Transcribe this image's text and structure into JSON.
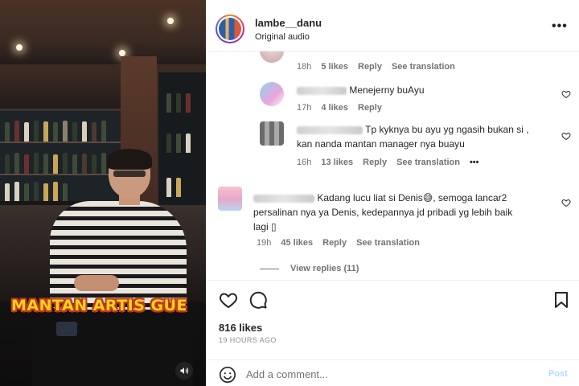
{
  "video": {
    "overlay_caption": "MANTAN ARTIS GUE",
    "mute_icon": "speaker-icon"
  },
  "post_header": {
    "username": "lambe__danu",
    "audio": "Original audio",
    "more_icon": "more-dots-icon"
  },
  "comments": [
    {
      "text": "",
      "time": "18h",
      "likes": "5 likes",
      "reply": "Reply",
      "translate": "See translation"
    },
    {
      "text": "Menejerny buAyu",
      "time": "17h",
      "likes": "4 likes",
      "reply": "Reply"
    },
    {
      "username_partial": "missprettyyo",
      "text_line1": "Tp kyknya bu ayu yg ngasih bukan si ,",
      "text_line2": "kan nanda mantan manager nya buayu",
      "time": "16h",
      "likes": "13 likes",
      "reply": "Reply",
      "translate": "See translation",
      "more": "•••"
    },
    {
      "text_line1": "Kadang lucu liat si Denis😅, semoga lancar2",
      "text_line2": "persalinan nya ya Denis, kedepannya jd pribadi yg lebih baik",
      "text_line3": "lagi ▯",
      "time": "19h",
      "likes": "45 likes",
      "reply": "Reply",
      "translate": "See translation"
    }
  ],
  "view_replies": "View replies (11)",
  "actions": {
    "like_icon": "heart-icon",
    "comment_icon": "comment-icon",
    "save_icon": "bookmark-icon"
  },
  "likes_count": "816 likes",
  "posted_ago": "19 HOURS AGO",
  "add_comment": {
    "placeholder": "Add a comment...",
    "post_label": "Post",
    "emoji_icon": "smiley-icon"
  },
  "colors": {
    "caption_yellow": "#ffd21a",
    "caption_outline": "#c0391b",
    "post_button": "#b3dbff",
    "meta_gray": "#737373"
  }
}
